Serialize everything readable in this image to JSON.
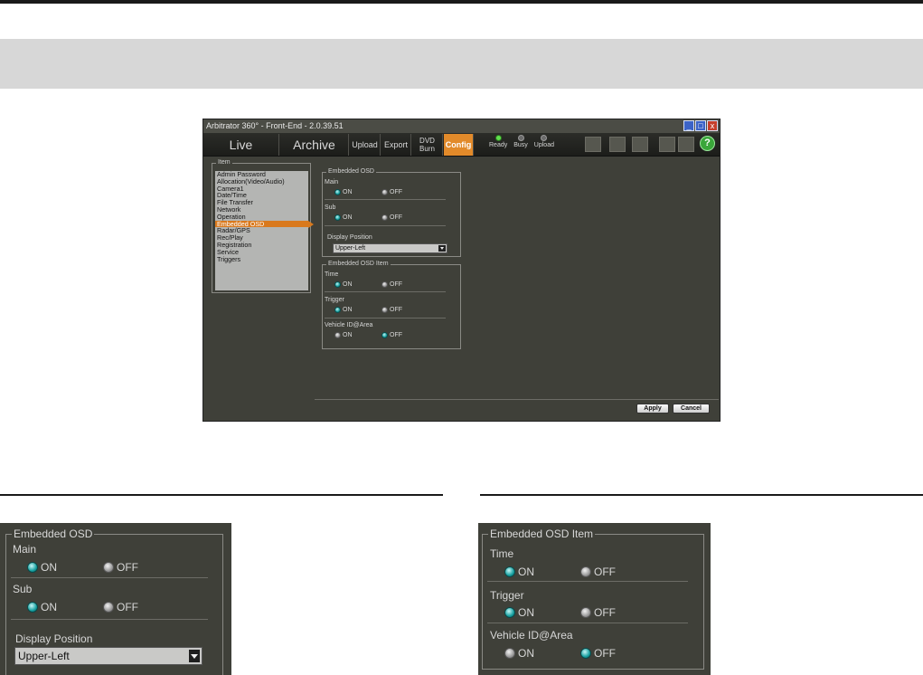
{
  "window": {
    "title": "Arbitrator 360° - Front-End - 2.0.39.51",
    "minimize": "_",
    "maximize": "□",
    "close": "x"
  },
  "nav": {
    "live": "Live",
    "archive": "Archive",
    "upload": "Upload",
    "export": "Export",
    "dvd_line1": "DVD",
    "dvd_line2": "Burn",
    "config": "Config",
    "status": [
      {
        "label": "Ready",
        "on": true
      },
      {
        "label": "Busy",
        "on": false
      },
      {
        "label": "Upload",
        "on": false
      }
    ],
    "help": "?"
  },
  "item_list": {
    "legend": "Item",
    "items": [
      "Admin Password",
      "Allocation(Video/Audio)",
      "Camera1",
      "Date/Time",
      "File Transfer",
      "Network",
      "Operation",
      "Embedded OSD",
      "Radar/GPS",
      "Rec/Play",
      "Registration",
      "Service",
      "Triggers"
    ],
    "selected": "Embedded OSD"
  },
  "embedded_osd": {
    "legend": "Embedded OSD",
    "main_label": "Main",
    "sub_label": "Sub",
    "on_label": "ON",
    "off_label": "OFF",
    "main_value": "ON",
    "sub_value": "ON",
    "display_position_label": "Display Position",
    "display_position_value": "Upper-Left"
  },
  "embedded_osd_item": {
    "legend": "Embedded OSD Item",
    "time_label": "Time",
    "trigger_label": "Trigger",
    "vehicle_label": "Vehicle ID@Area",
    "on_label": "ON",
    "off_label": "OFF",
    "time_value": "ON",
    "trigger_value": "ON",
    "vehicle_value": "OFF"
  },
  "footer": {
    "apply": "Apply",
    "cancel": "Cancel"
  }
}
